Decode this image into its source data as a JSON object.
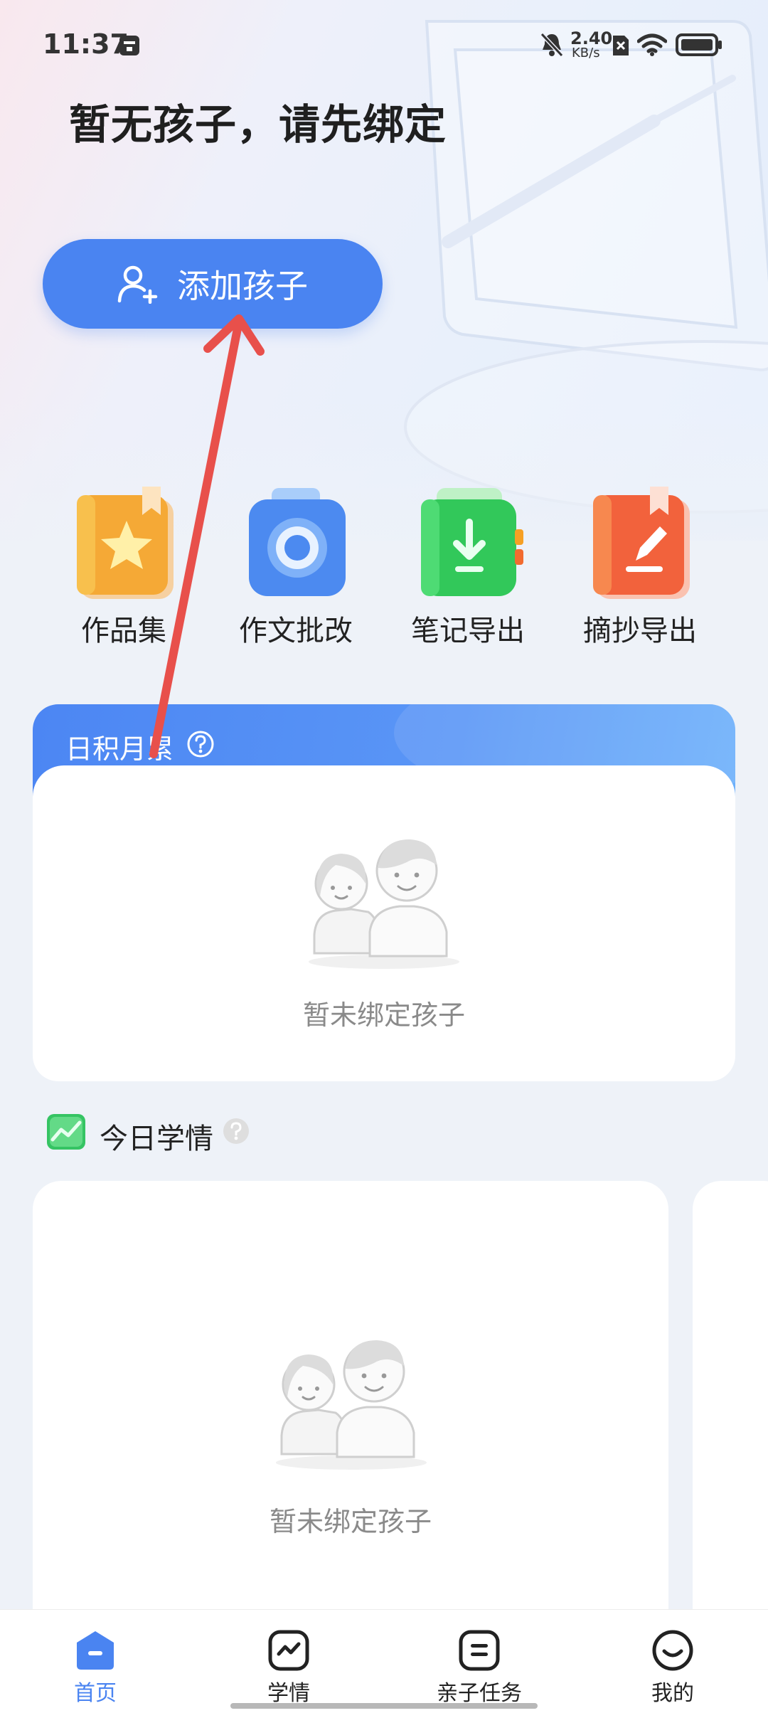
{
  "status_bar": {
    "time": "11:37",
    "network_speed_value": "2.40",
    "network_speed_unit": "KB/s",
    "icons": [
      "notification-icon",
      "mute-icon",
      "sim-off-icon",
      "wifi-icon",
      "battery-icon"
    ]
  },
  "header": {
    "title": "暂无孩子，请先绑定",
    "add_child_label": "添加孩子"
  },
  "quick_actions": [
    {
      "label": "作品集",
      "icon": "portfolio-icon"
    },
    {
      "label": "作文批改",
      "icon": "camera-icon"
    },
    {
      "label": "笔记导出",
      "icon": "notes-export-icon"
    },
    {
      "label": "摘抄导出",
      "icon": "excerpt-export-icon"
    }
  ],
  "accumulation": {
    "title": "日积月累",
    "empty_text": "暂未绑定孩子"
  },
  "today": {
    "title": "今日学情",
    "empty_text": "暂未绑定孩子"
  },
  "bottom_nav": [
    {
      "label": "首页",
      "icon": "home-icon",
      "active": true
    },
    {
      "label": "学情",
      "icon": "trend-icon",
      "active": false
    },
    {
      "label": "亲子任务",
      "icon": "task-icon",
      "active": false
    },
    {
      "label": "我的",
      "icon": "profile-icon",
      "active": false
    }
  ],
  "colors": {
    "accent": "#4a84f1",
    "annotation_arrow": "#e8504b"
  }
}
